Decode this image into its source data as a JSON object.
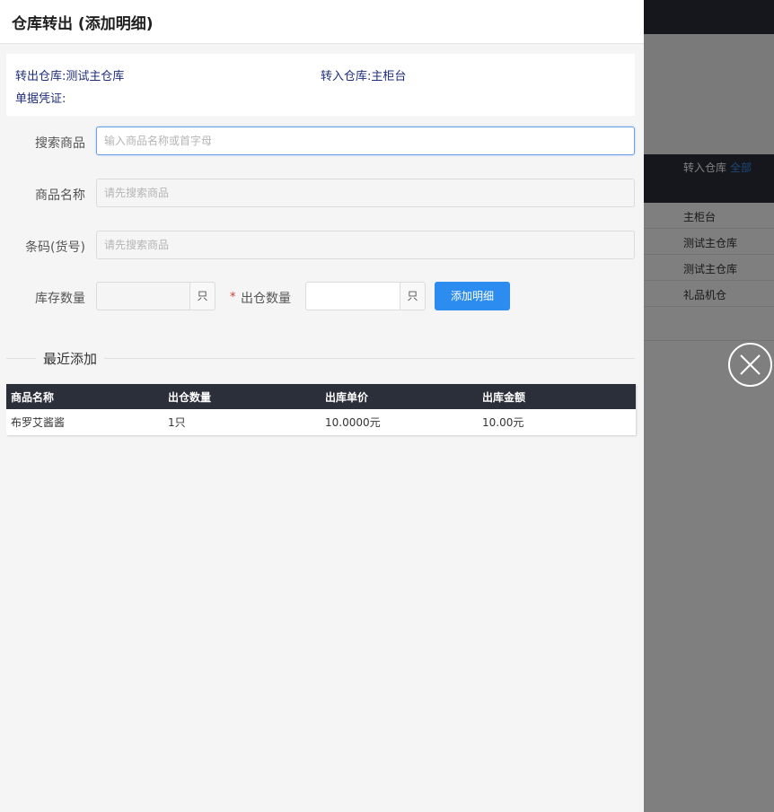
{
  "background": {
    "table_header": "转入仓库",
    "filter_label": "全部",
    "rows": [
      "主柜台",
      "测试主仓库",
      "测试主仓库",
      "礼品机仓"
    ]
  },
  "drawer": {
    "title": "仓库转出 (添加明细)",
    "info": {
      "from_warehouse": "转出仓库:测试主仓库",
      "to_warehouse": "转入仓库:主柜台",
      "voucher": "单据凭证:"
    },
    "form": {
      "search_label": "搜索商品",
      "search_placeholder": "输入商品名称或首字母",
      "name_label": "商品名称",
      "name_placeholder": "请先搜索商品",
      "barcode_label": "条码(货号)",
      "barcode_placeholder": "请先搜索商品",
      "stock_label": "库存数量",
      "stock_unit": "只",
      "required_mark": "*",
      "out_label": "出仓数量",
      "out_unit": "只",
      "add_button": "添加明细"
    },
    "recent": {
      "title": "最近添加",
      "columns": [
        "商品名称",
        "出仓数量",
        "出库单价",
        "出库金额"
      ],
      "rows": [
        [
          "布罗艾酱酱",
          "1只",
          "10.0000元",
          "10.00元"
        ]
      ]
    }
  },
  "colors": {
    "accent": "#2d8cf0",
    "header_dark": "#2b2f3a",
    "info_text": "#1f2d7a",
    "required": "#d9382b"
  }
}
